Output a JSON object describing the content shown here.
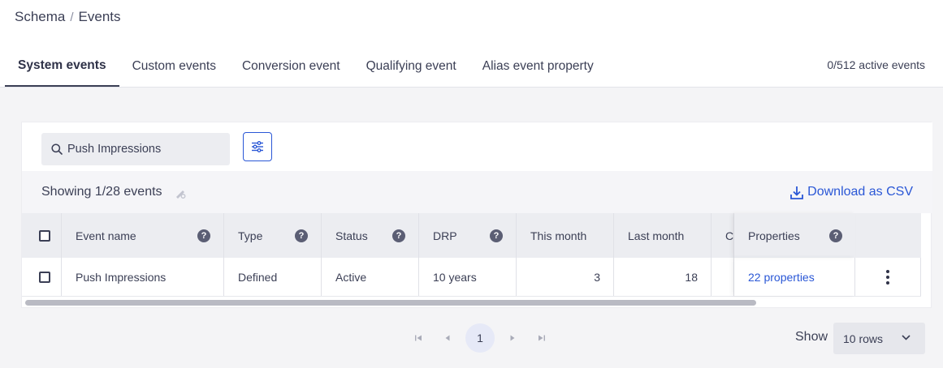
{
  "breadcrumb": {
    "parent": "Schema",
    "separator": "/",
    "current": "Events"
  },
  "tabs": [
    {
      "label": "System events",
      "active": true
    },
    {
      "label": "Custom events",
      "active": false
    },
    {
      "label": "Conversion event",
      "active": false
    },
    {
      "label": "Qualifying event",
      "active": false
    },
    {
      "label": "Alias event property",
      "active": false
    }
  ],
  "active_events": "0/512 active events",
  "search": {
    "value": "Push Impressions",
    "icon": "search-icon"
  },
  "summary": {
    "showing": "Showing 1/28 events"
  },
  "download_label": "Download as CSV",
  "table": {
    "columns": [
      "Event name",
      "Type",
      "Status",
      "DRP",
      "This month",
      "Last month",
      "C",
      "Properties"
    ],
    "help_marker": "?",
    "rows": [
      {
        "event_name": "Push Impressions",
        "type": "Defined",
        "status": "Active",
        "drp": "10 years",
        "this_month": "3",
        "last_month": "18",
        "c": "",
        "properties": "22 properties"
      }
    ]
  },
  "pagination": {
    "current_page": "1"
  },
  "rows_per_page": {
    "label": "Show",
    "value": "10 rows"
  },
  "colors": {
    "accent": "#2a57d6",
    "text": "#3b3f55",
    "header_bg": "#ecedf1",
    "page_bg": "#f4f4f6"
  }
}
